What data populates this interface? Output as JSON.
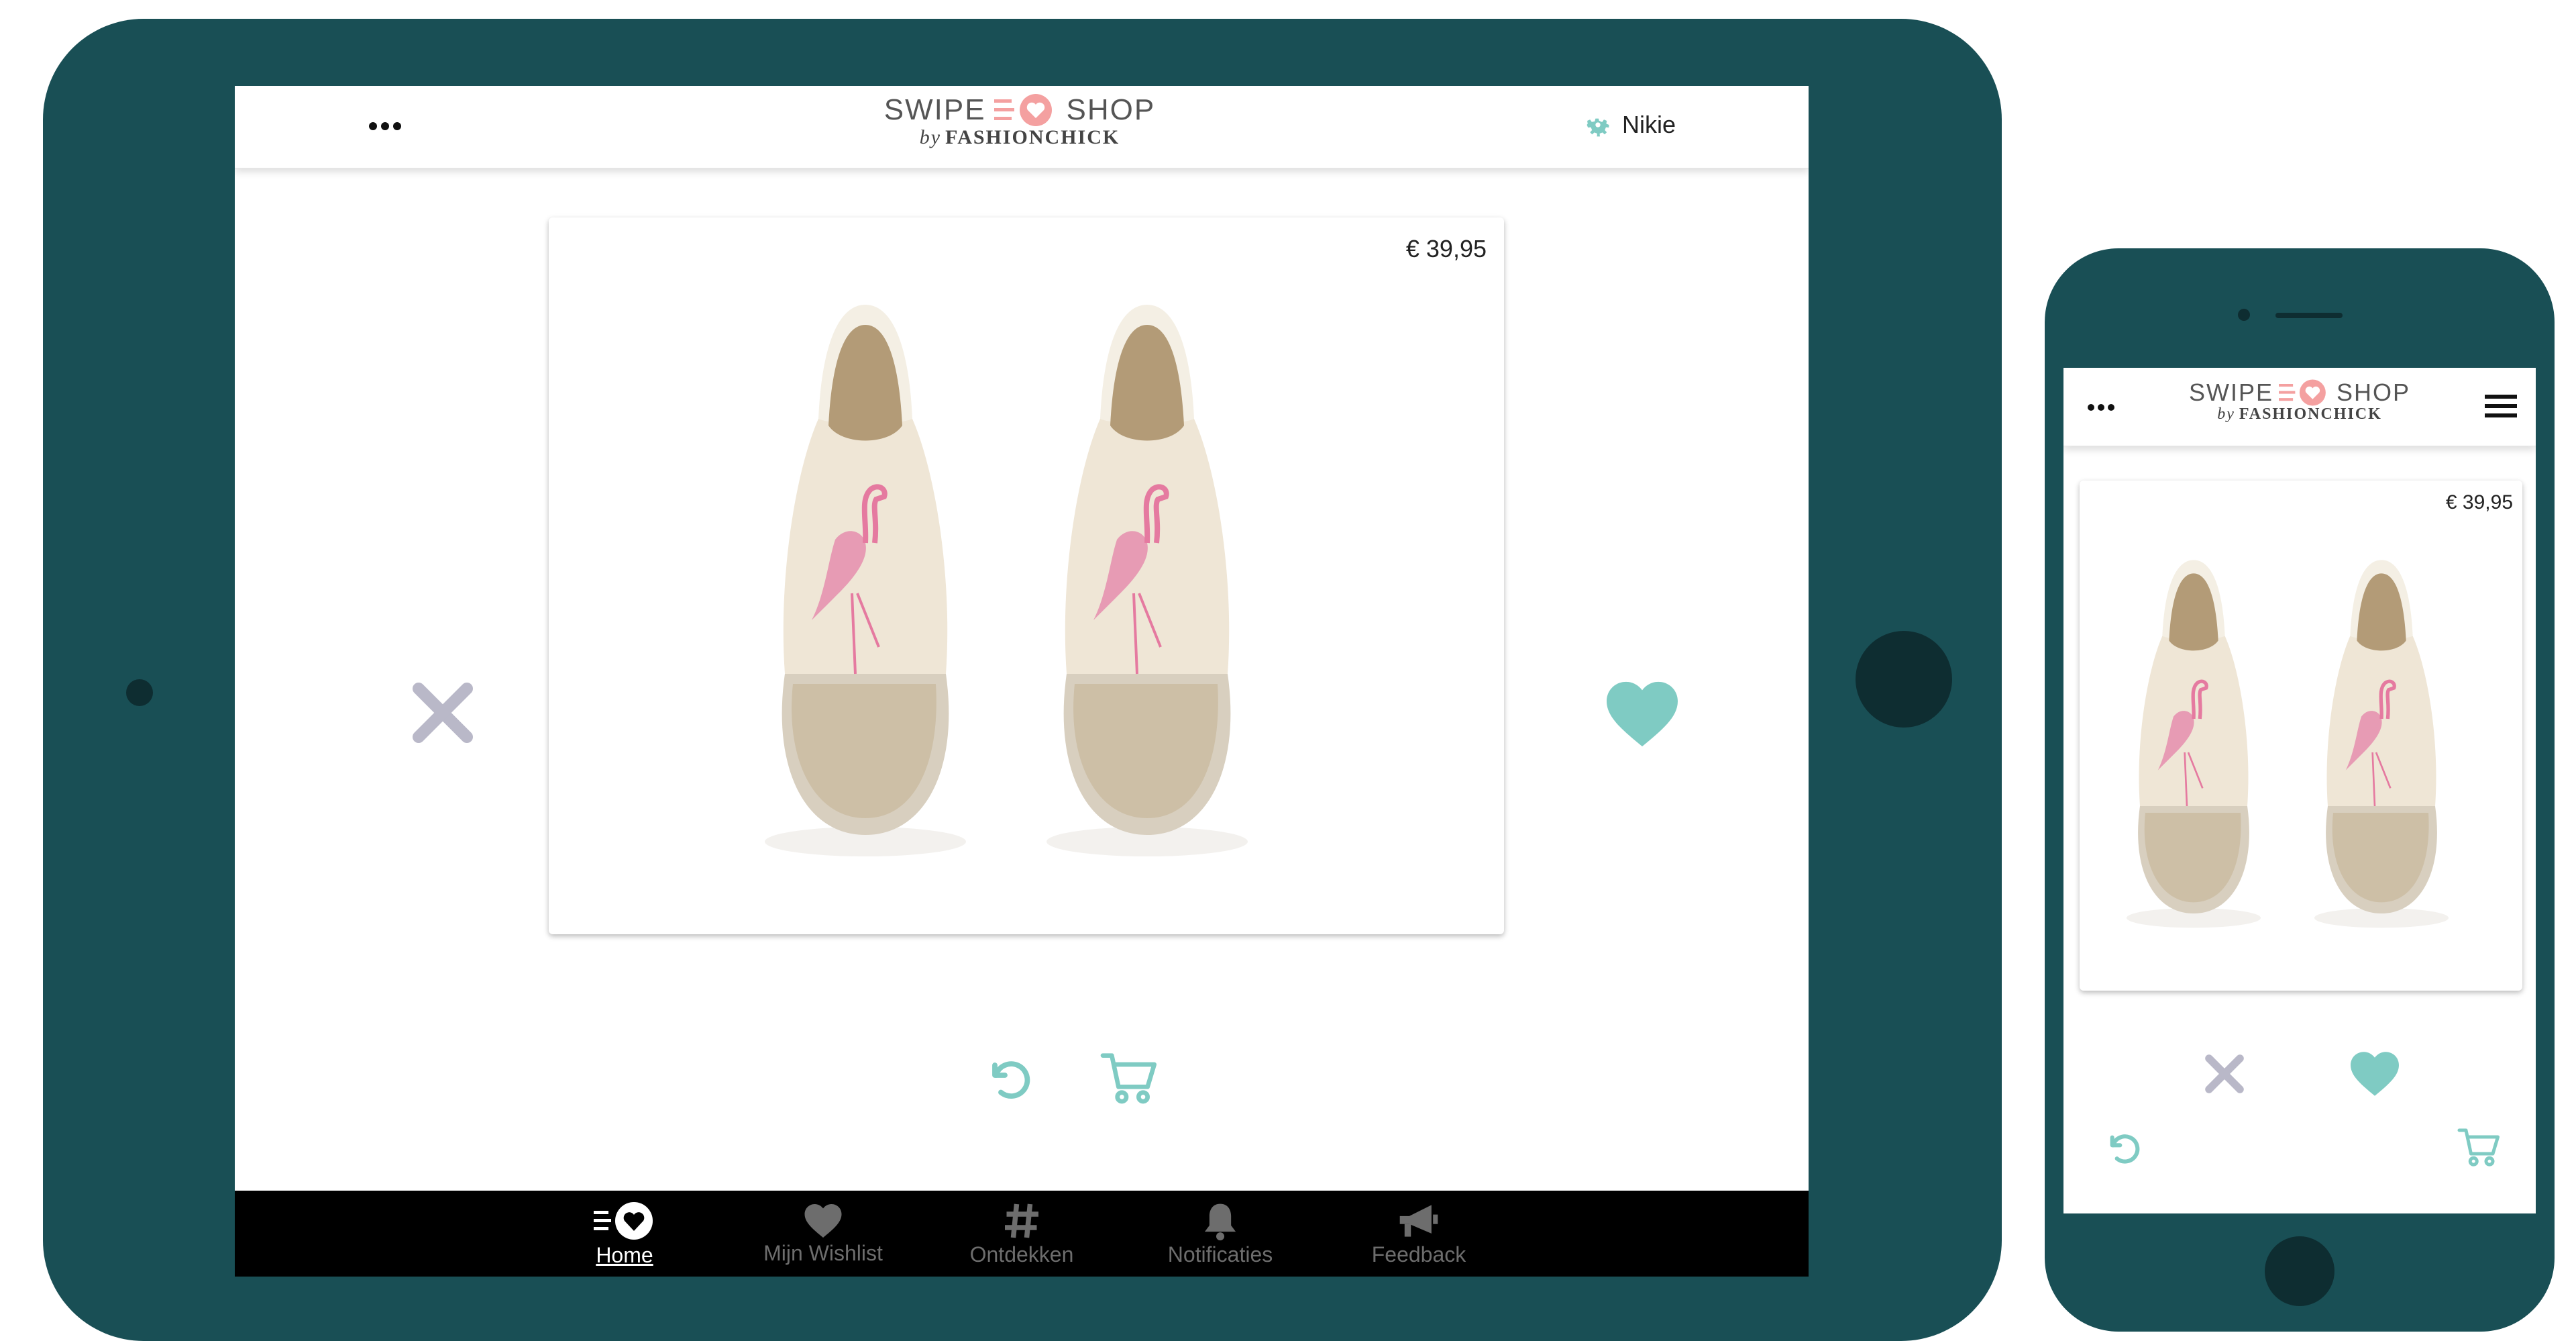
{
  "brand": {
    "swipe": "SWIPE",
    "shop": "SHOP",
    "by": "by",
    "fashionchick": "FASHIONCHICK",
    "accent": "#f4a0a0"
  },
  "tablet": {
    "user_name": "Nikie",
    "product_price": "€ 39,95",
    "nav": [
      {
        "label": "Home",
        "icon": "home-heart-icon",
        "active": true
      },
      {
        "label": "Mijn Wishlist",
        "icon": "heart-icon",
        "active": false
      },
      {
        "label": "Ontdekken",
        "icon": "hashtag-icon",
        "active": false
      },
      {
        "label": "Notificaties",
        "icon": "bell-icon",
        "active": false
      },
      {
        "label": "Feedback",
        "icon": "megaphone-icon",
        "active": false
      }
    ]
  },
  "phone": {
    "product_price": "€ 39,95"
  },
  "colors": {
    "device": "#194f55",
    "teal_action": "#7fcbc3",
    "dislike_gray": "#b9b8c8"
  }
}
